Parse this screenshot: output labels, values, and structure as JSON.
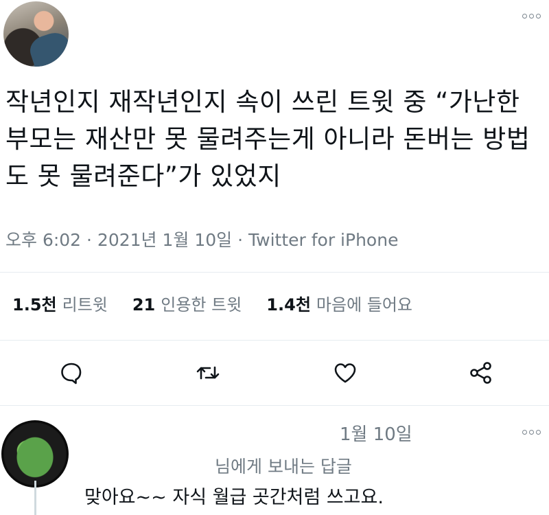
{
  "tweet": {
    "text": "작년인지 재작년인지 속이 쓰린 트윗 중 “가난한 부모는 재산만 못 물려주는게 아니라 돈버는 방법도 못 물려준다”가 있었지",
    "meta": "오후 6:02 · 2021년 1월 10일 · Twitter for iPhone"
  },
  "stats": {
    "retweets_count": "1.5천",
    "retweets_label": "리트윗",
    "quotes_count": "21",
    "quotes_label": "인용한 트윗",
    "likes_count": "1.4천",
    "likes_label": "마음에 들어요"
  },
  "actions": {
    "reply_icon": "speech-bubble-icon",
    "retweet_icon": "retweet-icon",
    "like_icon": "heart-icon",
    "share_icon": "share-icon"
  },
  "reply": {
    "date": "1월 10일",
    "replying_to": "님에게 보내는 답글",
    "text": "맞아요~~ 자식 월급 곳간처럼 쓰고요."
  },
  "colors": {
    "text": "#0f1419",
    "secondary": "#6f7a83",
    "accent": "#1d9bf0",
    "divider": "#e6ecf0"
  }
}
